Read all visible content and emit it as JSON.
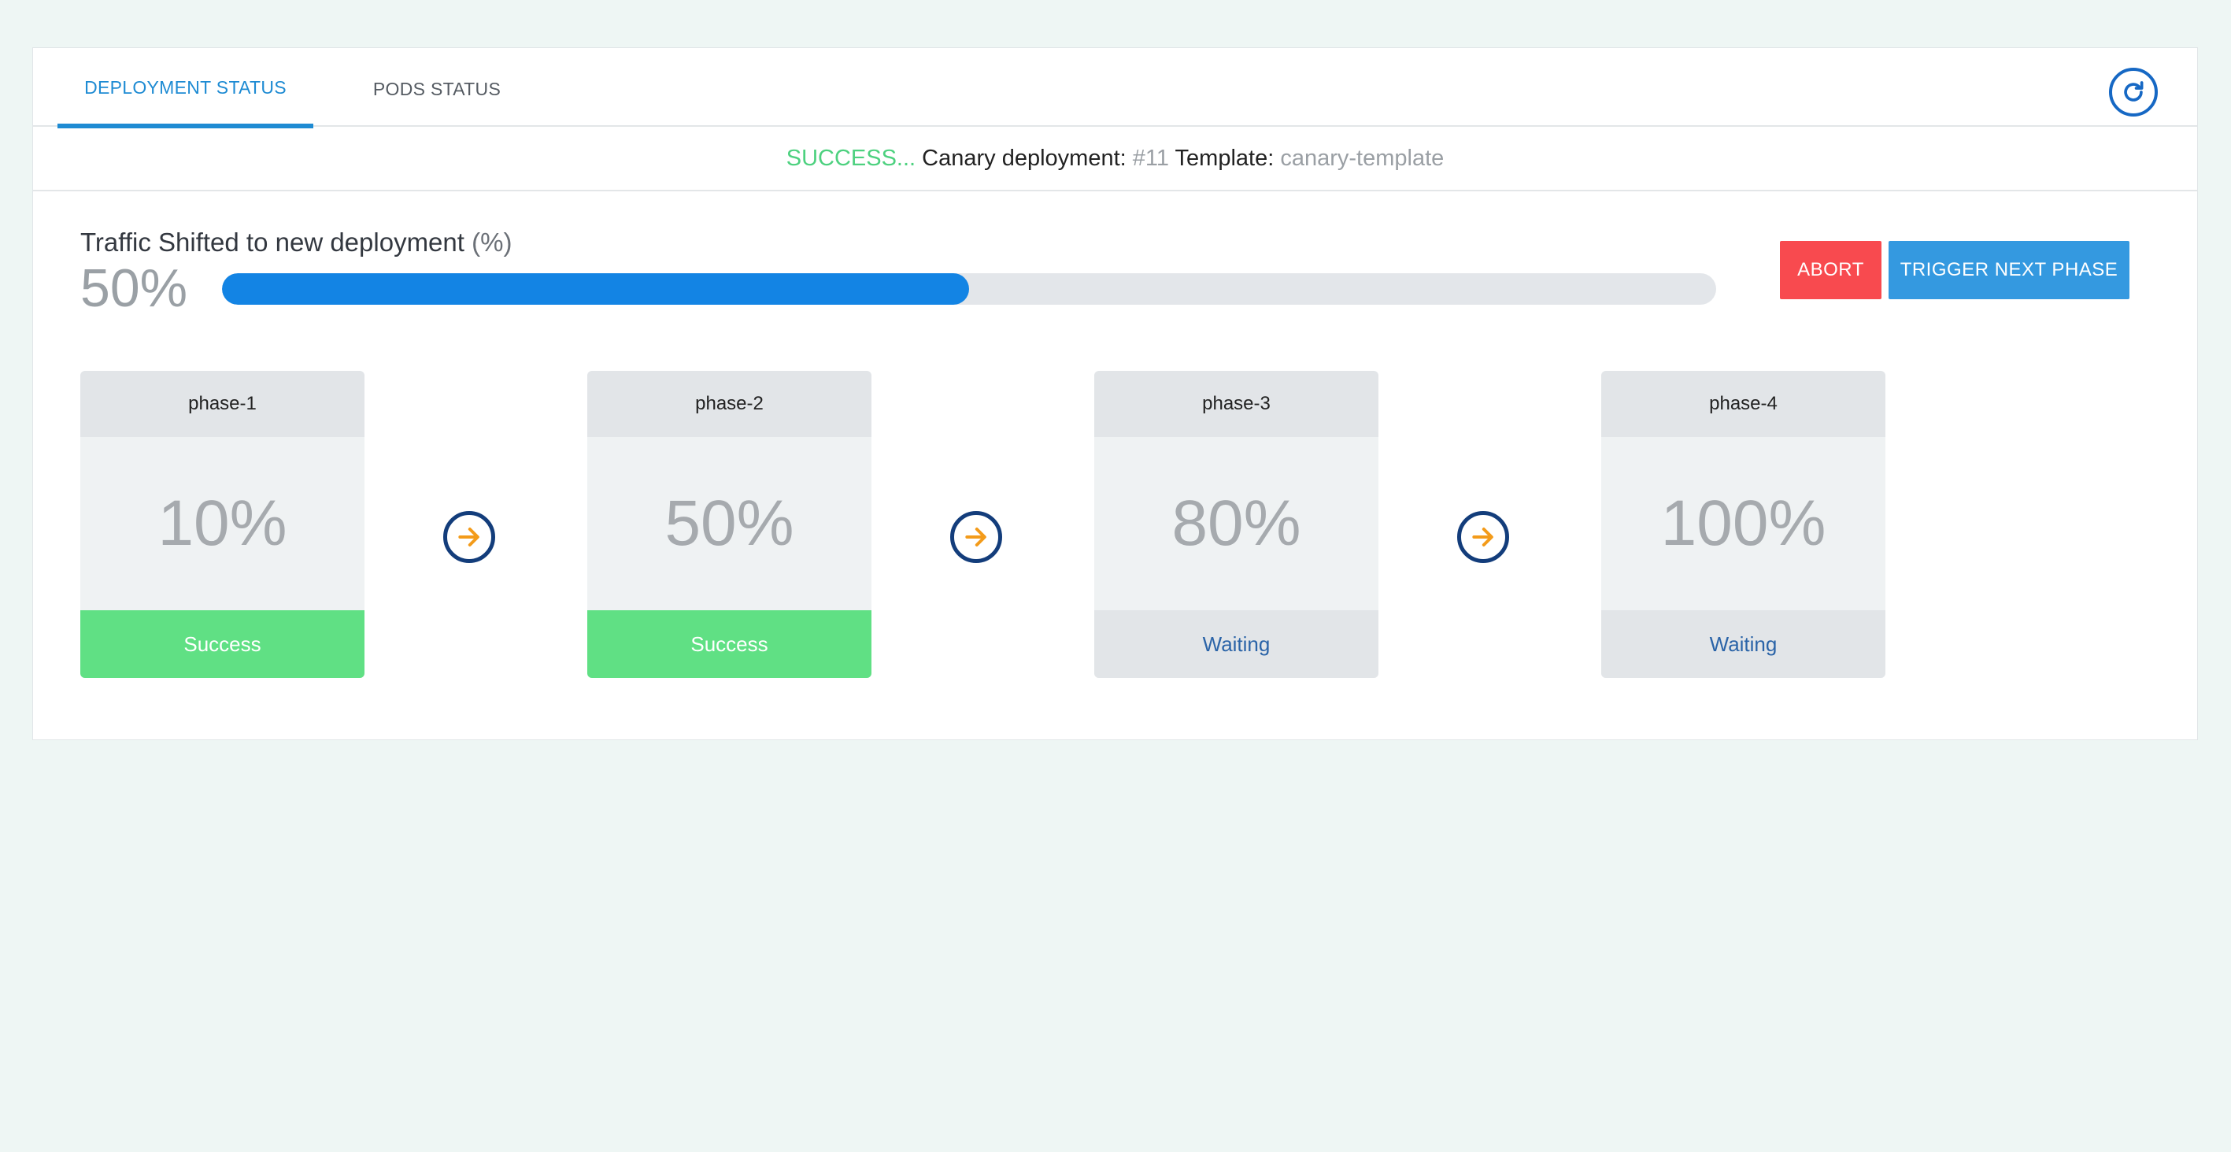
{
  "tabs": {
    "deployment_status": "DEPLOYMENT STATUS",
    "pods_status": "PODS STATUS"
  },
  "status_line": {
    "state": "SUCCESS...",
    "deployment_label": " Canary deployment: ",
    "deployment_number": "#11",
    "template_label": " Template: ",
    "template_name": "canary-template"
  },
  "traffic": {
    "label": "Traffic Shifted to new deployment ",
    "unit": "(%)",
    "value_text": "50%",
    "progress_percent": 50
  },
  "actions": {
    "abort": "ABORT",
    "trigger_next": "TRIGGER NEXT PHASE"
  },
  "phases": [
    {
      "name": "phase-1",
      "percent": "10%",
      "status": "Success"
    },
    {
      "name": "phase-2",
      "percent": "50%",
      "status": "Success"
    },
    {
      "name": "phase-3",
      "percent": "80%",
      "status": "Waiting"
    },
    {
      "name": "phase-4",
      "percent": "100%",
      "status": "Waiting"
    }
  ],
  "colors": {
    "success": "#60e084",
    "waiting": "#e2e5e8",
    "progress": "#1384e4",
    "abort": "#f84a4f",
    "primary": "#3499e0",
    "arrow": "#f39b1a"
  },
  "icons": {
    "refresh": "refresh-icon",
    "phase_arrow": "arrow-right-circle-icon"
  }
}
